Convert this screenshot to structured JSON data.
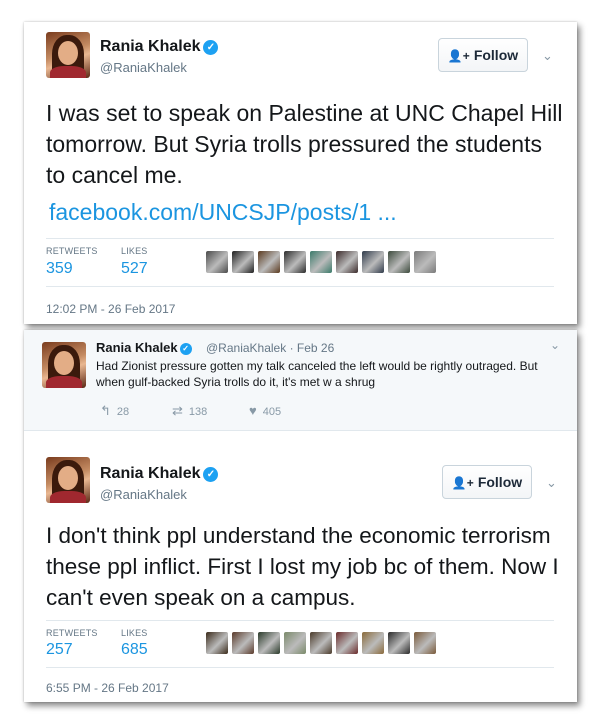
{
  "tweet1": {
    "name": "Rania Khalek",
    "handle": "@RaniaKhalek",
    "follow_label": "Follow",
    "text": "I was set to speak on Palestine at UNC Chapel Hill tomorrow. But Syria trolls pressured the students to cancel me.",
    "link": "facebook.com/UNCSJP/posts/1 ...",
    "retweets_label": "RETWEETS",
    "retweets": "359",
    "likes_label": "LIKES",
    "likes": "527",
    "timestamp": "12:02 PM - 26 Feb 2017",
    "liker_colors": [
      "#4a4a4a",
      "#1f1f1f",
      "#5b3a1f",
      "#2b2b2b",
      "#3a7a6a",
      "#3b2a2a",
      "#2f3a4a",
      "#3c4a3c",
      "#7a7a7a"
    ]
  },
  "reply": {
    "name": "Rania Khalek",
    "handle": "@RaniaKhalek",
    "date": "Feb 26",
    "text": "Had Zionist pressure gotten my talk canceled the left would be rightly outraged. But when gulf-backed Syria trolls do it, it's met w a shrug",
    "replies": "28",
    "retweets": "138",
    "likes": "405"
  },
  "tweet2": {
    "name": "Rania Khalek",
    "handle": "@RaniaKhalek",
    "follow_label": "Follow",
    "text": "I don't think ppl understand the economic terrorism these ppl inflict. First I lost my job bc of them. Now I can't even speak on a campus.",
    "retweets_label": "RETWEETS",
    "retweets": "257",
    "likes_label": "LIKES",
    "likes": "685",
    "timestamp": "6:55 PM - 26 Feb 2017",
    "liker_colors": [
      "#3a2a1a",
      "#5a3a2a",
      "#2a3a2a",
      "#7a8a6a",
      "#4a3a2a",
      "#6a2a2a",
      "#8a6a3a",
      "#2a2a2a",
      "#7a5a3a"
    ]
  },
  "icons": {
    "verified": "✓",
    "follow": "person-plus-icon",
    "chevron": "chevron-down-icon",
    "reply": "↰",
    "retweet": "⇄",
    "like": "♥"
  },
  "colors": {
    "link": "#1b95e0",
    "verified": "#1da1f2",
    "muted": "#657786"
  }
}
